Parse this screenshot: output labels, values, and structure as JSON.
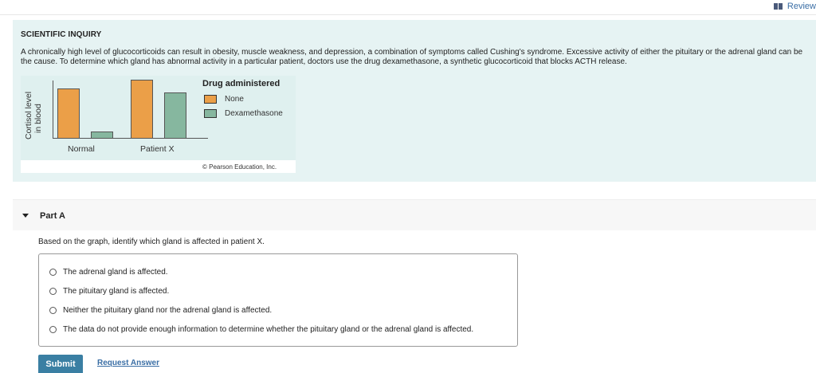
{
  "header": {
    "review_label": "Review"
  },
  "inquiry": {
    "title": "SCIENTIFIC INQUIRY",
    "body": "A chronically high level of glucocorticoids can result in obesity, muscle weakness, and depression, a combination of symptoms called Cushing's syndrome. Excessive activity of either the pituitary or the adrenal gland can be the cause. To determine which gland has abnormal activity in a particular patient, doctors use the drug dexamethasone, a synthetic glucocorticoid that blocks ACTH release."
  },
  "chart_data": {
    "type": "bar",
    "categories": [
      "Normal",
      "Patient X"
    ],
    "series": [
      {
        "name": "None",
        "values": [
          0.85,
          1.0
        ]
      },
      {
        "name": "Dexamethasone",
        "values": [
          0.12,
          0.78
        ]
      }
    ],
    "ylabel_line1": "Cortisol level",
    "ylabel_line2": "in blood",
    "legend_title": "Drug administered",
    "legend_placement": "right",
    "colors": {
      "None": "#eb9f48",
      "Dexamethasone": "#86b79f"
    },
    "copyright": "© Pearson Education, Inc.",
    "ylim": [
      0,
      1
    ]
  },
  "part": {
    "title": "Part A",
    "question": "Based on the graph, identify which gland is affected in patient X.",
    "choices": [
      "The adrenal gland is affected.",
      "The pituitary gland is affected.",
      "Neither the pituitary gland nor the adrenal gland is affected.",
      "The data do not provide enough information to determine whether the pituitary gland or the adrenal gland is affected."
    ]
  },
  "actions": {
    "submit_label": "Submit",
    "request_label": "Request Answer"
  }
}
